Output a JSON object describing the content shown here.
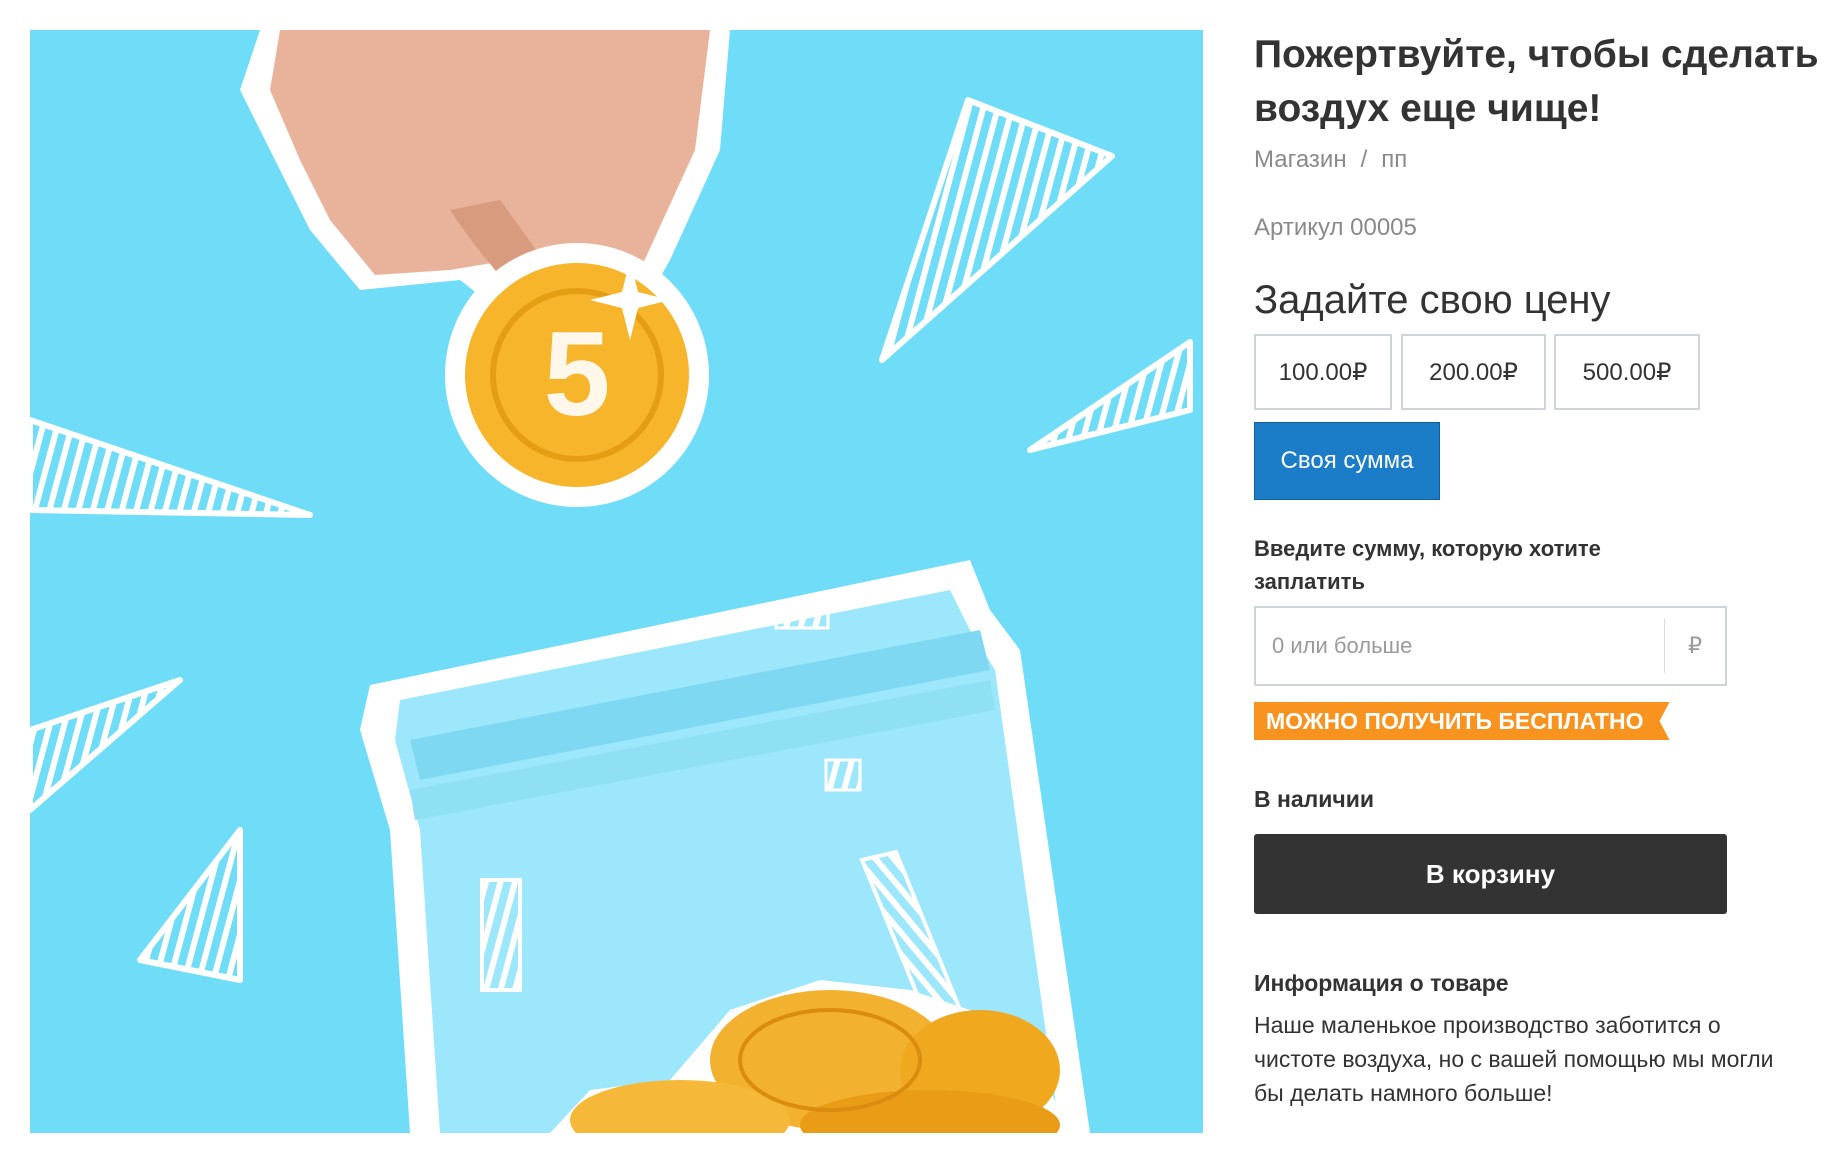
{
  "product": {
    "title_line1": "Пожертвуйте, чтобы сделать",
    "title_line2": "воздух еще чище!",
    "breadcrumb": [
      "Магазин",
      "/",
      "пп"
    ],
    "sku": "Артикул 00005"
  },
  "pricing": {
    "heading": "Задайте свою цену",
    "amounts": [
      "100.00₽",
      "200.00₽",
      "500.00₽"
    ],
    "custom_label": "Своя сумма",
    "enter_label": "Введите сумму, которую хотите заплатить",
    "input_placeholder": "0 или больше",
    "currency": "₽",
    "free_badge": "МОЖНО ПОЛУЧИТЬ БЕСПЛАТНО"
  },
  "availability": "В наличии",
  "cart_button": "В корзину",
  "details": {
    "heading": "Информация о товаре",
    "text": "Наше маленькое производство заботится о чистоте воздуха, но с вашей помощью мы могли бы делать намного больше!"
  },
  "colors": {
    "image_background": "#6fdcf8",
    "selected_button": "#1b7cc7",
    "cart_button": "#333333",
    "free_badge": "#f7931e"
  }
}
